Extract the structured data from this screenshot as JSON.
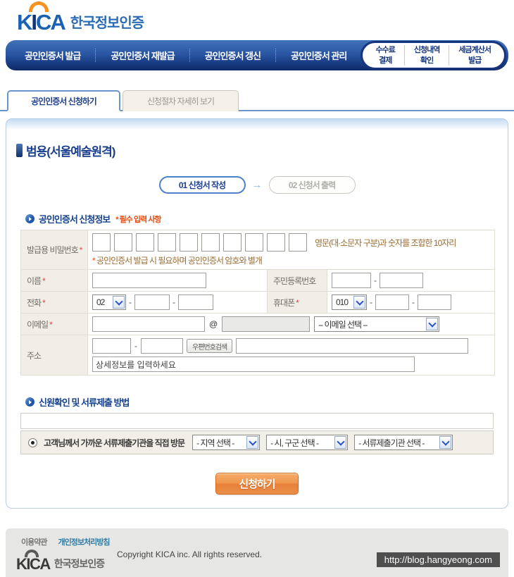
{
  "brand": {
    "logo_k": "K",
    "logo_i": "I",
    "logo_ca": "CA",
    "logo_korean": "한국정보인증"
  },
  "nav": {
    "items": [
      {
        "label": "공인인증서 발급"
      },
      {
        "label": "공인인증서 재발급"
      },
      {
        "label": "공인인증서 갱신"
      },
      {
        "label": "공인인증서 관리"
      }
    ],
    "quick_links": [
      {
        "line1": "수수료",
        "line2": "결제"
      },
      {
        "line1": "신청내역",
        "line2": "확인"
      },
      {
        "line1": "세금계산서",
        "line2": "발급"
      }
    ]
  },
  "tabs": {
    "active": "공인인증서 신청하기",
    "inactive": "신청절차 자세히 보기"
  },
  "page": {
    "title": "범용(서울예술원격)"
  },
  "steps": {
    "step1": "01 신청서 작성",
    "step2": "02 신청서 출력",
    "arrow": "→"
  },
  "form": {
    "section_title": "공인인증서 신청정보",
    "required_note": "* 필수 입력 사항",
    "password": {
      "label": "발급용 비밀번호",
      "box_count": 10,
      "hint": "영문(대·소문자 구분)과 숫자를 조합한 10자리",
      "note_star": "*",
      "note": "공인인증서 발급 시 필요하며 공인인증서 암호와 별개"
    },
    "name_label": "이름",
    "jumin_label": "주민등록번호",
    "phone_label": "전화",
    "phone_prefix": "02",
    "mobile_label": "휴대폰",
    "mobile_prefix": "010",
    "email_label": "이메일",
    "email_at": "@",
    "email_select": "-- 이메일 선택 --",
    "address_label": "주소",
    "zipcode_button": "우편번호검색",
    "address_detail_value": "상세정보를 입력하세요"
  },
  "verify": {
    "section_title": "신원확인 및 서류제출 방법",
    "radio_label": "고객님께서 가까운 서류제출기관을 직접 방문",
    "region_select": "- 지역 선택 -",
    "city_select": "- 시, 구군 선택 -",
    "org_select": "- 서류제출기관 선택 -"
  },
  "submit_label": "신청하기",
  "footer": {
    "terms": "이용약관",
    "privacy": "개인정보처리방침",
    "logo_korean": "한국정보인증",
    "copyright": "Copyright KICA inc. All rights reserved.",
    "url": "http://blog.hangyeong.com"
  },
  "misc": {
    "dash": "-"
  },
  "colors": {
    "nav_navy": "#16357d",
    "brand_blue": "#1b62b4",
    "arc_orange": "#f6921e",
    "accent_blue_border": "#6a95cc",
    "title_navy": "#1a3f8e",
    "required_red": "#e8490e",
    "note_brown": "#9c6a2e",
    "label_bg_beige": "#f1eee7",
    "button_orange": "#e8823a",
    "footer_gray": "#e6e6e4",
    "url_box_gray": "#4f4f4f"
  }
}
